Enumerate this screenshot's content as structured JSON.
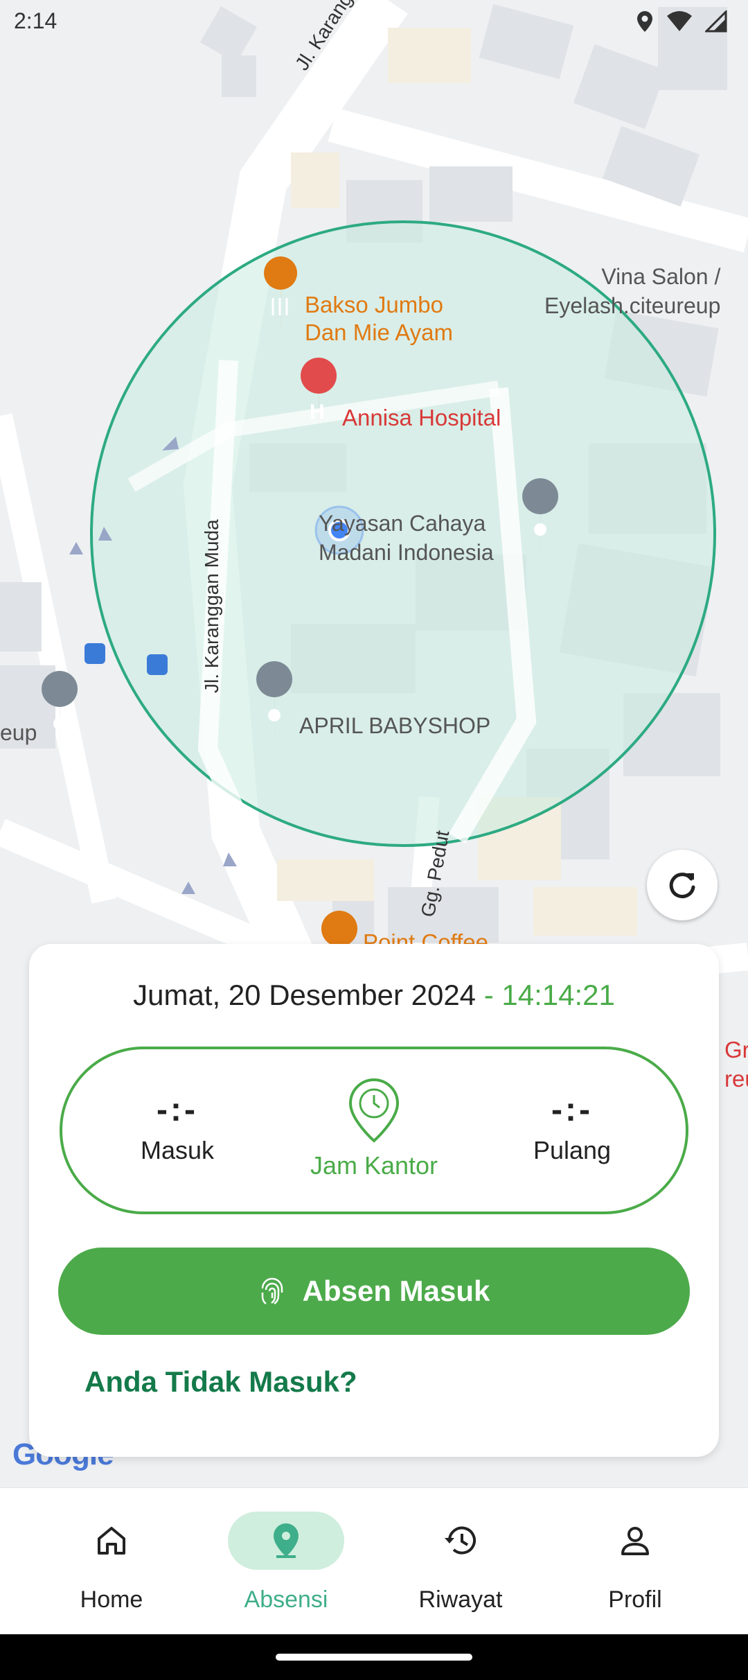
{
  "status_bar": {
    "time": "2:14"
  },
  "map": {
    "labels": {
      "street_top": "Jl. Karanggan Muda",
      "street_mid": "Jl. Karanggan Muda",
      "street_bottom": "Gg. Pedut",
      "bakso": "Bakso Jumbo\nDan Mie Ayam",
      "hospital": "Annisa Hospital",
      "yayasan": "Yayasan Cahaya\nMadani Indonesia",
      "babyshop": "APRIL BABYSHOP",
      "salon": "Vina Salon /\nEyelash.citeureup",
      "coffee": "Point Coffee",
      "left_edge": "eup",
      "right_edge": "Gr\nreu"
    },
    "colors": {
      "geofence": "#2daa82",
      "geofence_fill": "#c9ece0",
      "user_dot": "#4285f4"
    }
  },
  "card": {
    "date": "Jumat, 20 Desember 2024",
    "separator": " - ",
    "time": "14:14:21",
    "masuk": {
      "value": "-:-",
      "label": "Masuk"
    },
    "jam_kantor": {
      "label": "Jam Kantor",
      "icon": "clock-pin-icon"
    },
    "pulang": {
      "value": "-:-",
      "label": "Pulang"
    },
    "absen_button": "Absen Masuk",
    "absent_link": "Anda Tidak Masuk?",
    "accent": "#4caa4a"
  },
  "google": "Google",
  "nav": {
    "items": [
      {
        "label": "Home",
        "icon": "home-icon"
      },
      {
        "label": "Absensi",
        "icon": "location-pin-icon"
      },
      {
        "label": "Riwayat",
        "icon": "history-icon"
      },
      {
        "label": "Profil",
        "icon": "person-icon"
      }
    ],
    "active_color": "#3fae8a"
  }
}
